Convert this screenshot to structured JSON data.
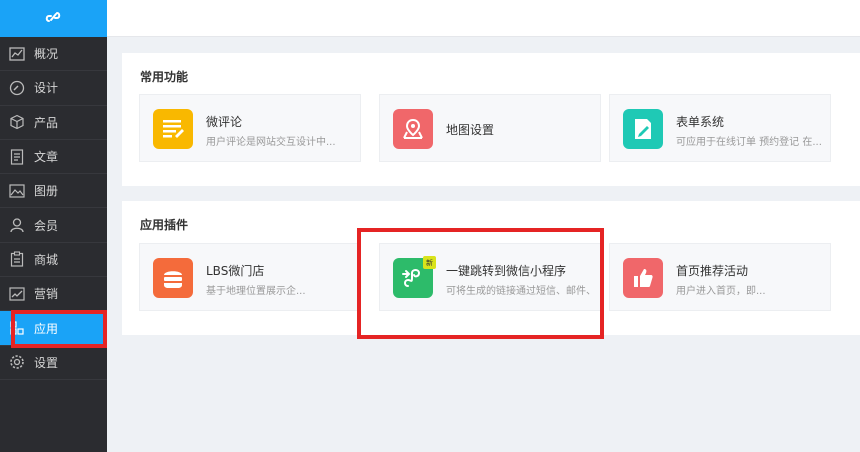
{
  "sidebar": {
    "logo_icon": "link-icon",
    "items": [
      {
        "label": "概况",
        "icon": "chart-line-icon"
      },
      {
        "label": "设计",
        "icon": "palette-icon"
      },
      {
        "label": "产品",
        "icon": "box-icon"
      },
      {
        "label": "文章",
        "icon": "document-icon"
      },
      {
        "label": "图册",
        "icon": "image-icon"
      },
      {
        "label": "会员",
        "icon": "user-icon"
      },
      {
        "label": "商城",
        "icon": "clipboard-icon"
      },
      {
        "label": "营销",
        "icon": "trend-icon"
      },
      {
        "label": "应用",
        "icon": "grid-icon",
        "active": true
      },
      {
        "label": "设置",
        "icon": "gear-icon"
      }
    ],
    "active_color": "#1aa3f7"
  },
  "common": {
    "title": "常用功能",
    "cards": [
      {
        "title": "微评论",
        "desc": "用户评论是网站交互设计中...",
        "icon": "comment-list-icon",
        "color": "#f9b800"
      },
      {
        "title": "地图设置",
        "desc": "",
        "icon": "map-pin-icon",
        "color": "#f0676a"
      },
      {
        "title": "表单系统",
        "desc": "可应用于在线订单 预约登记 在...",
        "icon": "form-edit-icon",
        "color": "#1fc9b5"
      }
    ]
  },
  "plugins": {
    "title": "应用插件",
    "cards": [
      {
        "title": "LBS微门店",
        "desc": "基于地理位置展示企...",
        "icon": "store-icon",
        "color": "#f46b3b"
      },
      {
        "title": "一键跳转到微信小程序",
        "desc": "可将生成的链接通过短信、邮件、",
        "icon": "miniprogram-icon",
        "color": "#2dbb6a",
        "badge": "新"
      },
      {
        "title": "首页推荐活动",
        "desc": "用户进入首页，即...",
        "icon": "thumbs-up-icon",
        "color": "#f0676a"
      }
    ]
  },
  "highlight_color": "#e52424"
}
